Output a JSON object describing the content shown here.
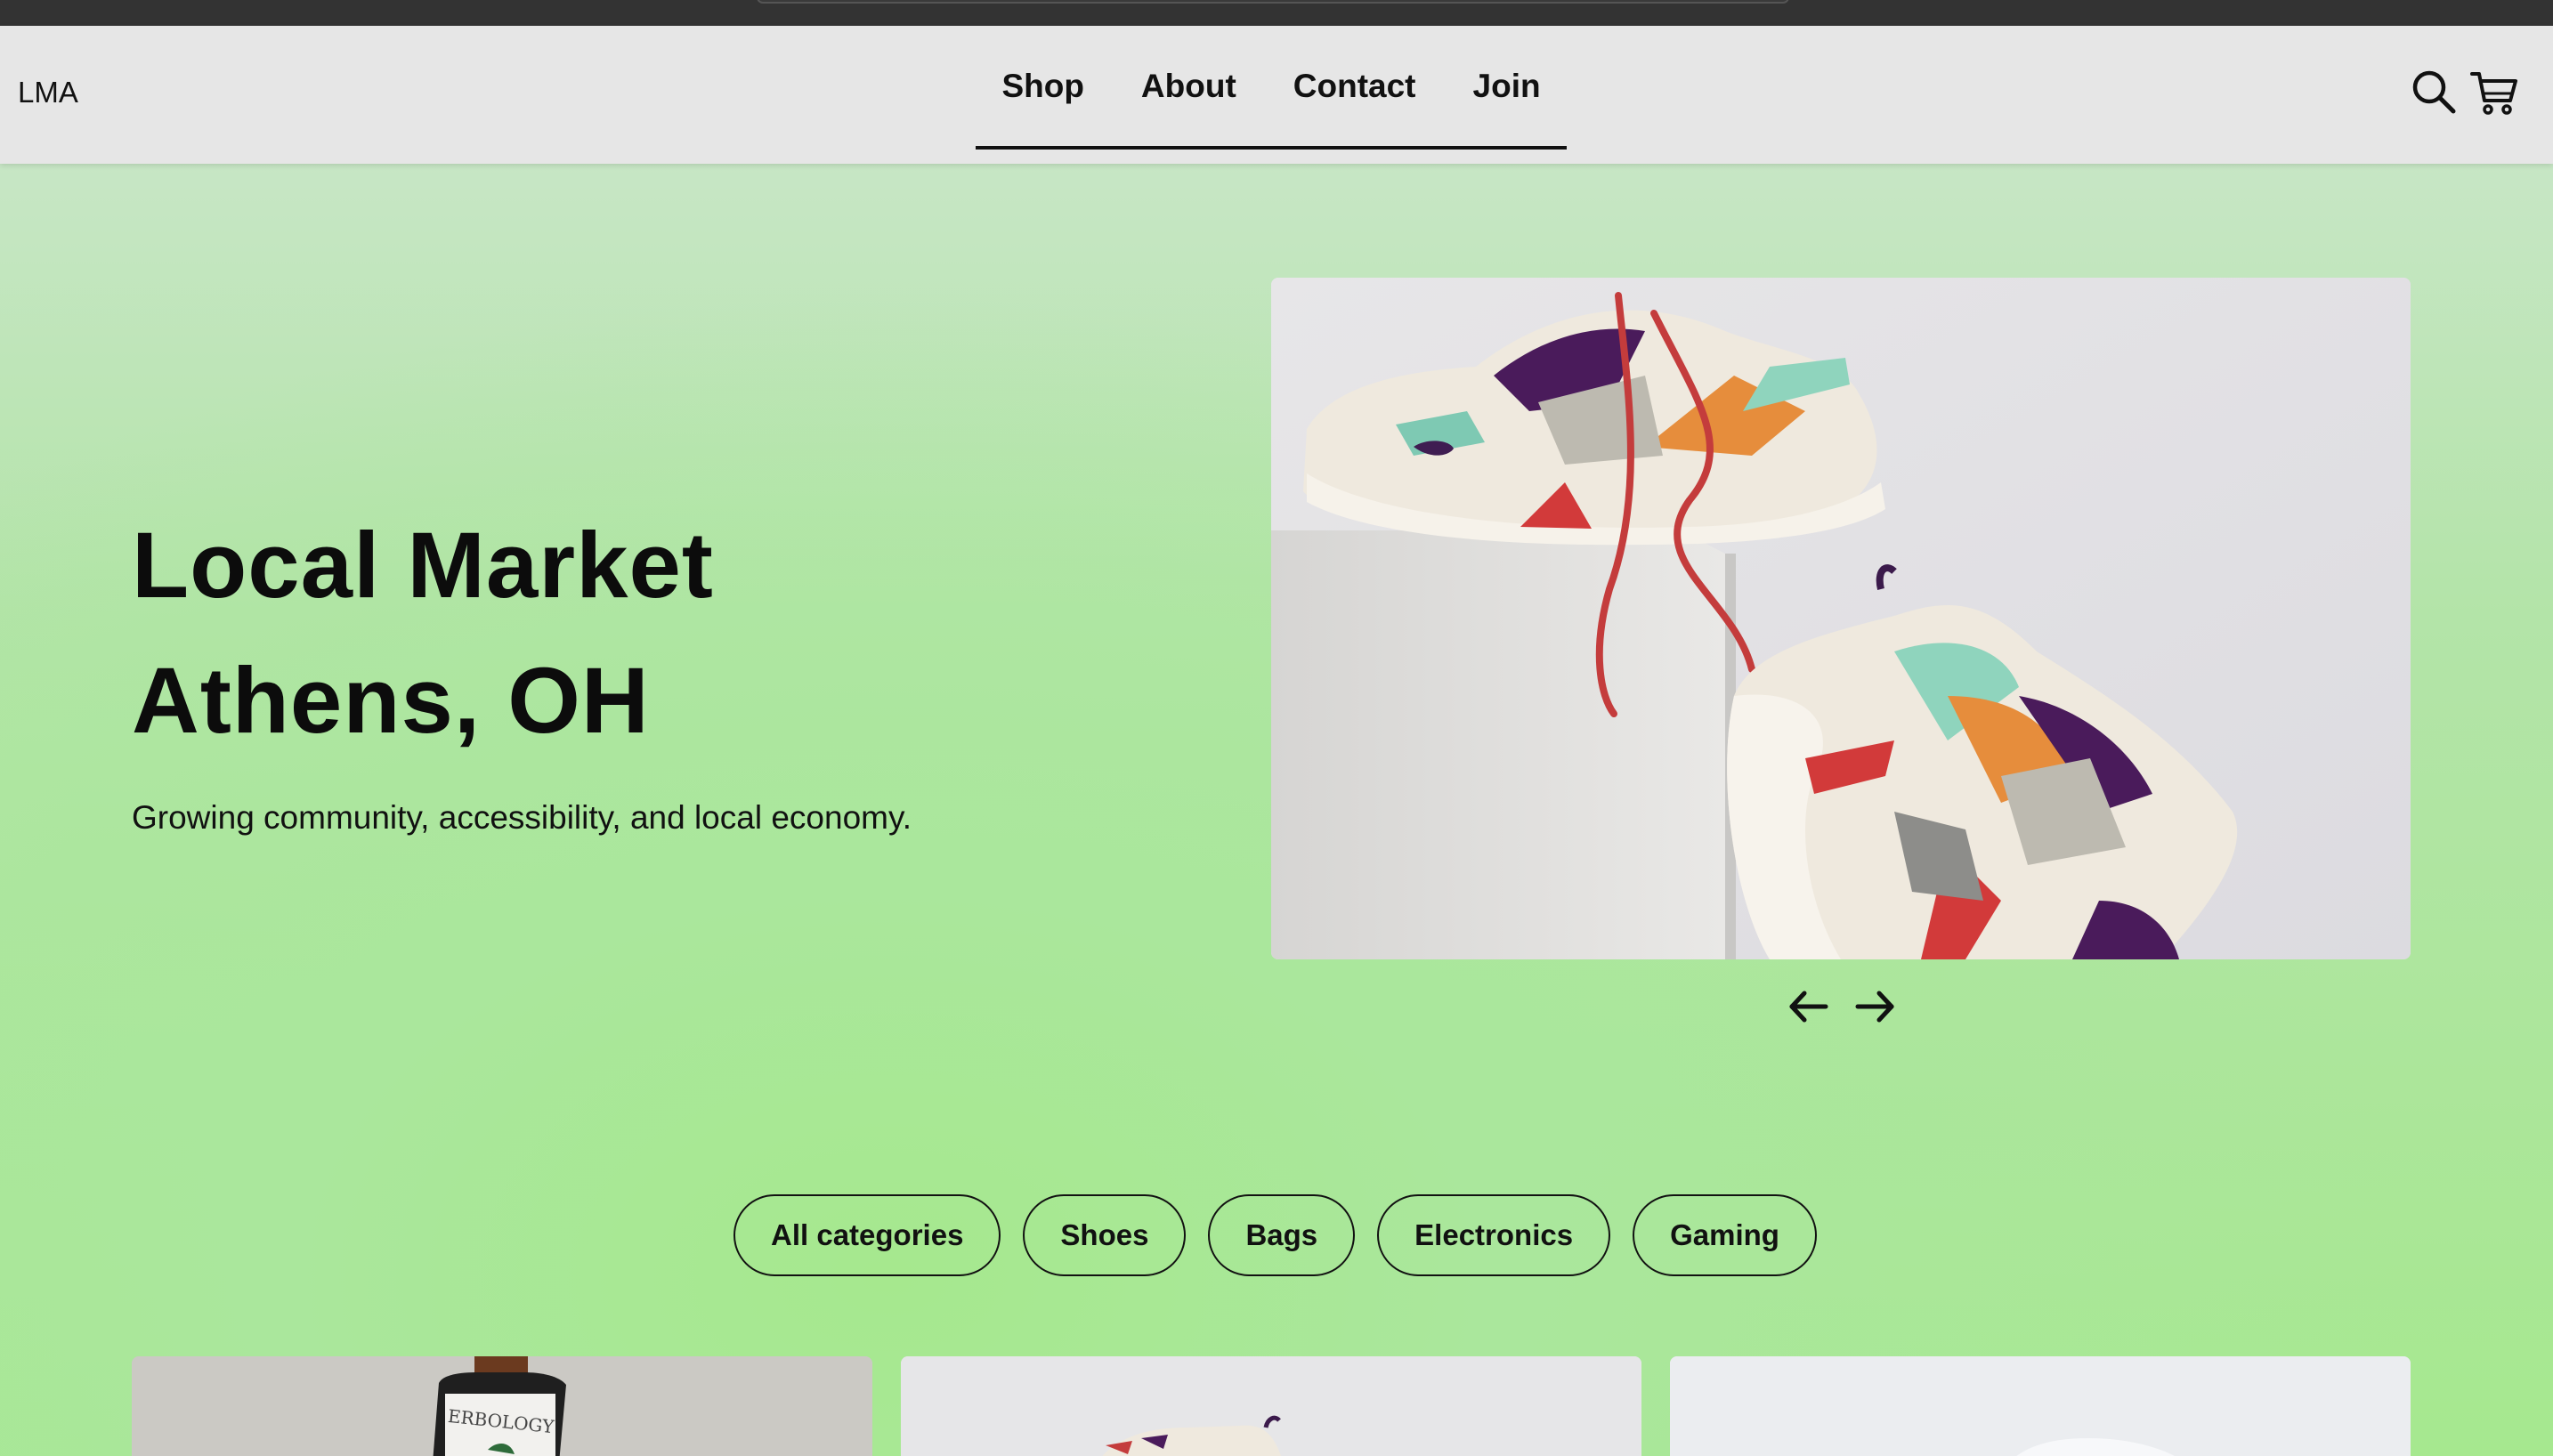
{
  "brand": "LMA",
  "nav": {
    "items": [
      "Shop",
      "About",
      "Contact",
      "Join"
    ]
  },
  "header_icons": [
    "search-icon",
    "cart-icon"
  ],
  "hero": {
    "title_line1": "Local Market",
    "title_line2": "Athens, OH",
    "subtitle": "Growing community, accessibility, and local economy."
  },
  "carousel": {
    "image": "sneakers-photo",
    "prev_icon": "arrow-left-icon",
    "next_icon": "arrow-right-icon"
  },
  "categories": [
    "All categories",
    "Shoes",
    "Bags",
    "Electronics",
    "Gaming"
  ],
  "product_cards": [
    {
      "label": "ERBOLOGY"
    },
    {
      "label": ""
    },
    {
      "label": ""
    }
  ],
  "colors": {
    "header_bg": "#e6e6e6",
    "hero_green": "#a8e89a",
    "text": "#0b0b0b",
    "top_strip": "#333333"
  }
}
